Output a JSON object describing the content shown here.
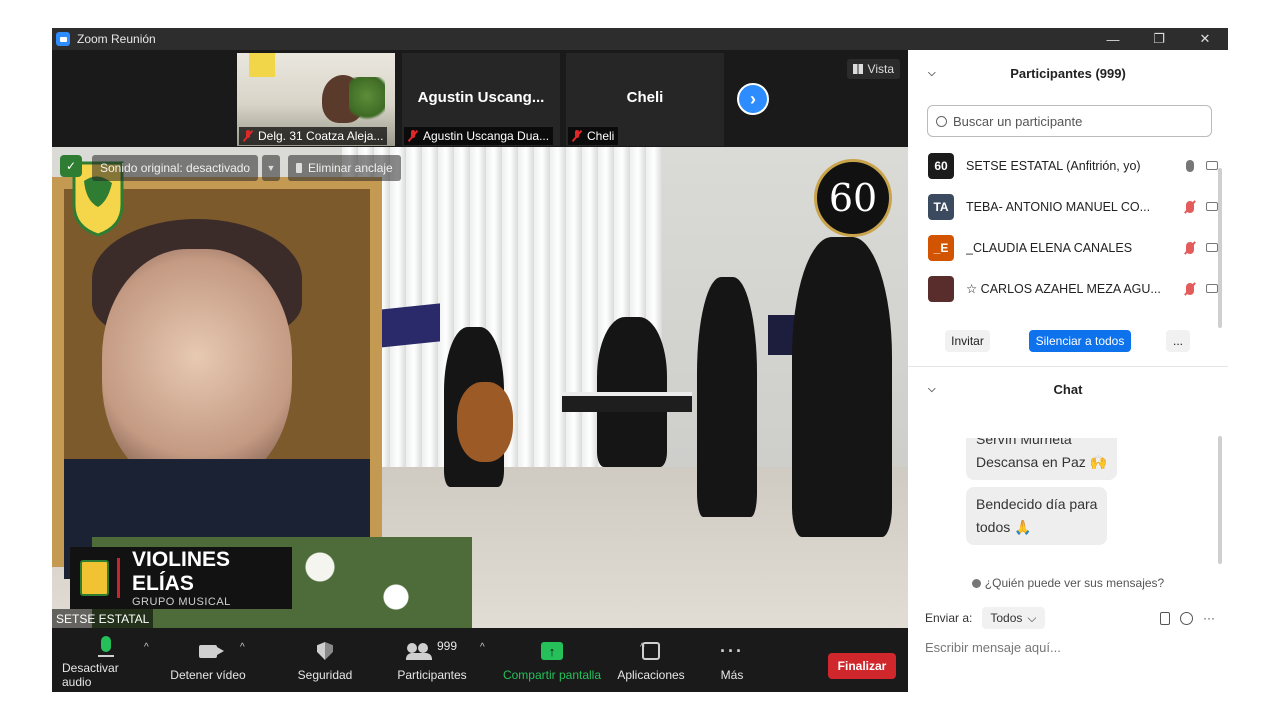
{
  "window": {
    "title": "Zoom Reunión",
    "controls": [
      "—",
      "❐",
      "✕"
    ]
  },
  "gallery": {
    "tiles": [
      {
        "label": "Delg. 31 Coatza Aleja..."
      },
      {
        "name": "Agustin  Uscang...",
        "label": "Agustin Uscanga Dua..."
      },
      {
        "name": "Cheli",
        "label": "Cheli"
      }
    ],
    "next": "›",
    "view_label": "Vista"
  },
  "video": {
    "original_sound": "Sonido original: desactivado",
    "unpin": "Eliminar anclaje",
    "banner_title": "VIOLINES ELÍAS",
    "banner_subtitle": "GRUPO MUSICAL",
    "anniversary": "60",
    "participant_name": "SETSE ESTATAL"
  },
  "toolbar": {
    "mute": "Desactivar audio",
    "video": "Detener vídeo",
    "security": "Seguridad",
    "participants": "Participantes",
    "participants_count": "999",
    "share": "Compartir pantalla",
    "apps": "Aplicaciones",
    "more": "Más",
    "end": "Finalizar",
    "caret": "^"
  },
  "participants_panel": {
    "title": "Participantes (999)",
    "search_placeholder": "Buscar un participante",
    "rows": [
      {
        "initials": "60",
        "name": "SETSE ESTATAL (Anfitrión, yo)",
        "color": "#1b1b1b"
      },
      {
        "initials": "TA",
        "name": "TEBA- ANTONIO MANUEL CO...",
        "color": "#3b4a5e"
      },
      {
        "initials": "_E",
        "name": "_CLAUDIA ELENA CANALES",
        "color": "#d35400"
      },
      {
        "initials": "",
        "name": "☆ CARLOS AZAHEL MEZA AGU...",
        "color": "#5a2d2d"
      }
    ],
    "invite": "Invitar",
    "mute_all": "Silenciar a todos",
    "more": "..."
  },
  "chat": {
    "title": "Chat",
    "messages": [
      "Servín Murrieta\nDescansa en Paz 🙌",
      "Bendecido día para\ntodos 🙏"
    ],
    "who_can_see": "¿Quién puede ver sus mensajes?",
    "send_to_label": "Enviar a:",
    "send_to_value": "Todos",
    "input_placeholder": "Escribir mensaje aquí..."
  },
  "colors": {
    "accent": "#0e72ed",
    "end": "#d0272d",
    "share": "#25c05a"
  }
}
